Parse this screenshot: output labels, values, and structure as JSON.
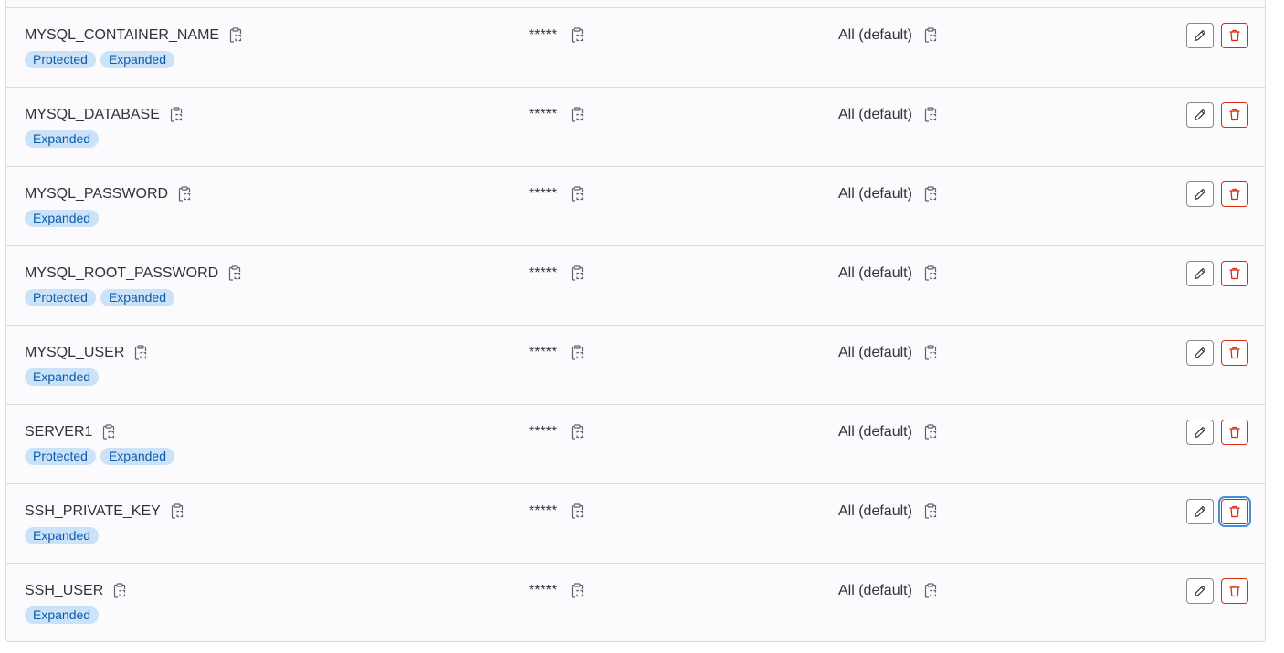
{
  "value_mask": "*****",
  "environment_default": "All (default)",
  "colors": {
    "badge_bg": "#cbe2f9",
    "badge_text": "#0b5cad",
    "delete": "#dd2b0e",
    "focus_ring": "#428fdc"
  },
  "icons": {
    "copy": "copy-to-clipboard-icon",
    "edit": "pencil-icon",
    "delete": "trash-icon"
  },
  "variables": [
    {
      "key": "MYSQL_CONTAINER_NAME",
      "value": "*****",
      "env": "All (default)",
      "badges": [
        "Protected",
        "Expanded"
      ]
    },
    {
      "key": "MYSQL_DATABASE",
      "value": "*****",
      "env": "All (default)",
      "badges": [
        "Expanded"
      ]
    },
    {
      "key": "MYSQL_PASSWORD",
      "value": "*****",
      "env": "All (default)",
      "badges": [
        "Expanded"
      ]
    },
    {
      "key": "MYSQL_ROOT_PASSWORD",
      "value": "*****",
      "env": "All (default)",
      "badges": [
        "Protected",
        "Expanded"
      ]
    },
    {
      "key": "MYSQL_USER",
      "value": "*****",
      "env": "All (default)",
      "badges": [
        "Expanded"
      ]
    },
    {
      "key": "SERVER1",
      "value": "*****",
      "env": "All (default)",
      "badges": [
        "Protected",
        "Expanded"
      ]
    },
    {
      "key": "SSH_PRIVATE_KEY",
      "value": "*****",
      "env": "All (default)",
      "badges": [
        "Expanded"
      ]
    },
    {
      "key": "SSH_USER",
      "value": "*****",
      "env": "All (default)",
      "badges": [
        "Expanded"
      ]
    }
  ]
}
